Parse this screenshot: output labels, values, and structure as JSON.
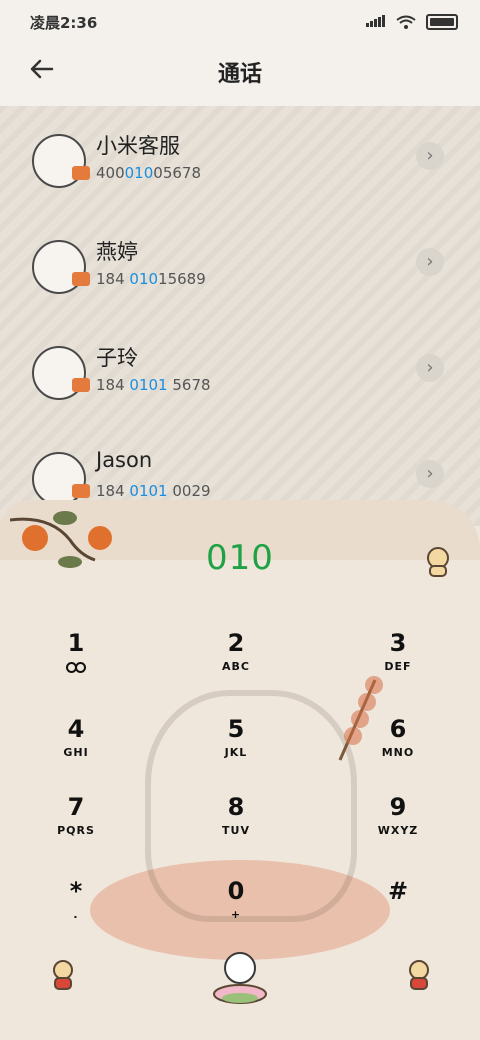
{
  "status": {
    "time": "凌晨2:36"
  },
  "header": {
    "title": "通话",
    "back_icon": "arrow-left-icon"
  },
  "contacts": [
    {
      "name": "小米客服",
      "num_pre": "400",
      "num_hl": "010",
      "num_post": "05678"
    },
    {
      "name": "燕婷",
      "num_pre": "184 ",
      "num_hl": "010",
      "num_post": "15689"
    },
    {
      "name": "子玲",
      "num_pre": "184 ",
      "num_hl": "0101",
      "num_post": " 5678"
    },
    {
      "name": "Jason",
      "num_pre": "184 ",
      "num_hl": "0101",
      "num_post": " 0029"
    }
  ],
  "dialer": {
    "entered": "010",
    "keys": [
      {
        "digit": "1",
        "letters": ""
      },
      {
        "digit": "2",
        "letters": "ABC"
      },
      {
        "digit": "3",
        "letters": "DEF"
      },
      {
        "digit": "4",
        "letters": "GHI"
      },
      {
        "digit": "5",
        "letters": "JKL"
      },
      {
        "digit": "6",
        "letters": "MNO"
      },
      {
        "digit": "7",
        "letters": "PQRS"
      },
      {
        "digit": "8",
        "letters": "TUV"
      },
      {
        "digit": "9",
        "letters": "WXYZ"
      },
      {
        "digit": "*",
        "letters": "."
      },
      {
        "digit": "0",
        "letters": "+"
      },
      {
        "digit": "#",
        "letters": ""
      }
    ]
  },
  "colors": {
    "accent_green": "#1fa245",
    "match_blue": "#1a8fe0"
  }
}
